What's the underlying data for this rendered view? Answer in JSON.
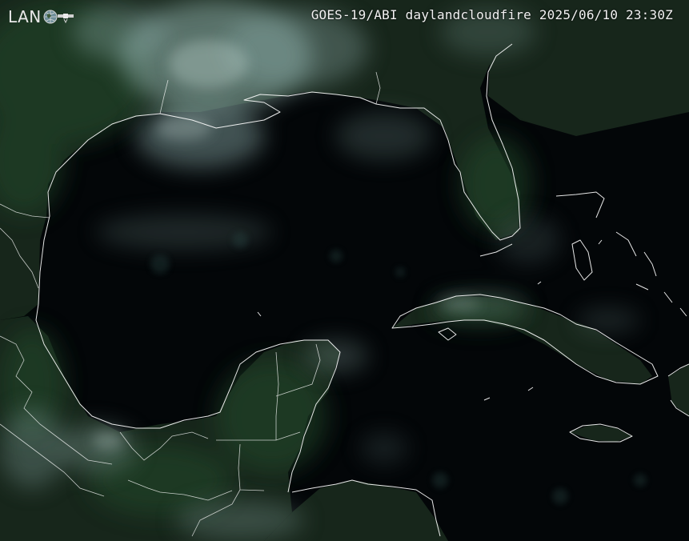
{
  "header": {
    "logo_text": "LAN",
    "logo_icons": [
      "globe-icon",
      "satellite-icon"
    ],
    "product_title": "GOES-19/ABI daylandcloudfire 2025/06/10 23:30Z"
  },
  "map": {
    "product": "daylandcloudfire",
    "colors": {
      "ocean": "#030608",
      "land": "#1b2c20",
      "vegetation": "#244a2c",
      "cloud": "#9ab8b4",
      "coastline": "#ffffff"
    }
  }
}
